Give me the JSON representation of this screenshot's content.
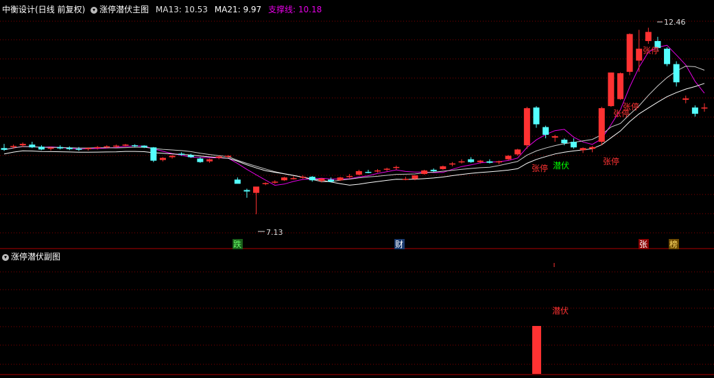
{
  "main_header": {
    "stock_name": "中衡设计",
    "period": "(日线 前复权)",
    "indicator_name": "涨停潜伏主图",
    "ma13": "MA13: 10.53",
    "ma21": "MA21: 9.97",
    "support": "支撑线: 10.18"
  },
  "sub_header": {
    "indicator_name": "涨停潜伏副图"
  },
  "labels": {
    "high_price": "12.46",
    "low_price": "7.13",
    "zhangting": "张停",
    "qianfu": "潜伏",
    "die": "跌",
    "cai": "财",
    "zhang": "张",
    "bang": "榜"
  },
  "colors": {
    "up": "#ff3232",
    "down": "#54ffff",
    "ma13": "#e800e8",
    "ma21": "#cfcfcf",
    "support": "#ffffff",
    "grid": "#8b0000"
  },
  "chart_data": {
    "type": "candlestick",
    "series": [
      {
        "name": "MA13",
        "values": []
      },
      {
        "name": "MA21",
        "values": []
      },
      {
        "name": "支撑线",
        "values": []
      }
    ],
    "candles": [
      [
        9.02,
        9.14,
        8.94,
        8.97
      ],
      [
        9.06,
        9.12,
        9.0,
        9.08
      ],
      [
        9.1,
        9.18,
        9.05,
        9.14
      ],
      [
        9.12,
        9.2,
        9.02,
        9.04
      ],
      [
        9.06,
        9.1,
        8.96,
        8.98
      ],
      [
        9.0,
        9.06,
        8.95,
        9.03
      ],
      [
        9.05,
        9.1,
        8.98,
        9.01
      ],
      [
        9.03,
        9.07,
        8.96,
        8.99
      ],
      [
        9.0,
        9.05,
        8.94,
        8.97
      ],
      [
        8.99,
        9.04,
        8.95,
        9.02
      ],
      [
        9.03,
        9.08,
        8.98,
        9.05
      ],
      [
        9.06,
        9.1,
        9.02,
        9.07
      ],
      [
        9.08,
        9.12,
        9.03,
        9.09
      ],
      [
        9.1,
        9.14,
        9.06,
        9.12
      ],
      [
        9.1,
        9.13,
        9.05,
        9.08
      ],
      [
        9.09,
        9.1,
        9.02,
        9.04
      ],
      [
        9.04,
        9.05,
        8.62,
        8.66
      ],
      [
        8.68,
        8.76,
        8.64,
        8.74
      ],
      [
        8.76,
        8.82,
        8.72,
        8.8
      ],
      [
        8.86,
        8.9,
        8.8,
        8.84
      ],
      [
        8.82,
        8.86,
        8.74,
        8.76
      ],
      [
        8.72,
        8.76,
        8.6,
        8.62
      ],
      [
        8.64,
        8.72,
        8.6,
        8.7
      ],
      [
        8.74,
        8.8,
        8.7,
        8.78
      ],
      [
        8.78,
        8.82,
        8.74,
        8.8
      ],
      [
        8.12,
        8.18,
        8.04,
        8.0
      ],
      [
        7.82,
        7.86,
        7.6,
        7.78
      ],
      [
        7.74,
        7.9,
        7.13,
        7.92
      ],
      [
        8.0,
        8.04,
        7.96,
        8.02
      ],
      [
        8.04,
        8.1,
        8.0,
        8.06
      ],
      [
        8.1,
        8.2,
        8.08,
        8.18
      ],
      [
        8.14,
        8.22,
        8.12,
        8.16
      ],
      [
        8.18,
        8.24,
        8.14,
        8.2
      ],
      [
        8.2,
        8.22,
        8.06,
        8.1
      ],
      [
        8.08,
        8.16,
        8.04,
        8.15
      ],
      [
        8.12,
        8.18,
        8.04,
        8.06
      ],
      [
        8.1,
        8.2,
        8.08,
        8.18
      ],
      [
        8.2,
        8.28,
        8.16,
        8.22
      ],
      [
        8.26,
        8.4,
        8.24,
        8.36
      ],
      [
        8.34,
        8.4,
        8.3,
        8.33
      ],
      [
        8.36,
        8.42,
        8.32,
        8.38
      ],
      [
        8.4,
        8.46,
        8.36,
        8.43
      ],
      [
        8.45,
        8.52,
        8.4,
        8.48
      ],
      [
        8.14,
        8.2,
        8.1,
        8.14
      ],
      [
        8.14,
        8.22,
        8.1,
        8.24
      ],
      [
        8.28,
        8.4,
        8.26,
        8.38
      ],
      [
        8.4,
        8.44,
        8.34,
        8.36
      ],
      [
        8.42,
        8.52,
        8.4,
        8.5
      ],
      [
        8.56,
        8.62,
        8.5,
        8.58
      ],
      [
        8.62,
        8.7,
        8.58,
        8.64
      ],
      [
        8.7,
        8.76,
        8.6,
        8.62
      ],
      [
        8.62,
        8.68,
        8.58,
        8.66
      ],
      [
        8.64,
        8.7,
        8.58,
        8.6
      ],
      [
        8.62,
        8.66,
        8.56,
        8.64
      ],
      [
        8.7,
        8.82,
        8.68,
        8.8
      ],
      [
        8.84,
        9.0,
        8.8,
        8.98
      ],
      [
        9.1,
        10.2,
        9.0,
        10.16
      ],
      [
        10.18,
        10.22,
        9.6,
        9.7
      ],
      [
        9.62,
        9.66,
        9.3,
        9.4
      ],
      [
        9.32,
        9.4,
        9.2,
        9.36
      ],
      [
        9.26,
        9.3,
        9.1,
        9.16
      ],
      [
        9.2,
        9.3,
        9.0,
        9.04
      ],
      [
        8.96,
        9.04,
        8.88,
        9.02
      ],
      [
        9.0,
        9.08,
        8.9,
        9.05
      ],
      [
        9.2,
        10.2,
        9.1,
        10.16
      ],
      [
        10.22,
        11.18,
        10.2,
        11.18
      ],
      [
        10.42,
        11.18,
        10.4,
        11.16
      ],
      [
        11.2,
        12.3,
        11.1,
        12.28
      ],
      [
        11.52,
        12.4,
        11.2,
        11.86
      ],
      [
        12.08,
        12.46,
        12.0,
        12.34
      ],
      [
        12.08,
        12.2,
        11.8,
        11.88
      ],
      [
        11.86,
        11.9,
        11.36,
        11.42
      ],
      [
        11.42,
        11.5,
        10.78,
        10.9
      ],
      [
        10.4,
        10.52,
        10.3,
        10.44
      ],
      [
        10.18,
        10.24,
        9.92,
        10.0
      ],
      [
        10.16,
        10.3,
        10.06,
        10.18
      ]
    ],
    "sub_panel_bars": [
      {
        "index": 57,
        "value": 1
      }
    ],
    "price_range": [
      6.5,
      12.9
    ]
  }
}
